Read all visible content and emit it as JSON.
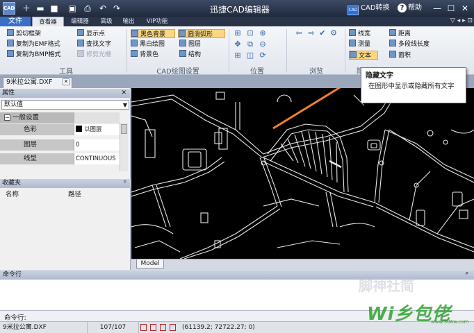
{
  "titlebar": {
    "logo": "CAD",
    "title": "迅捷CAD编辑器",
    "cad_convert": "CAD转换",
    "help": "帮助",
    "window_controls": [
      "minimize-icon",
      "maximize-icon",
      "close-icon"
    ]
  },
  "menu_tabs": [
    "文件",
    "查看器",
    "编辑器",
    "高级",
    "输出",
    "VIP功能"
  ],
  "active_tab": "查看器",
  "ribbon": {
    "tools": {
      "label": "工具",
      "items": [
        "剪切框架",
        "显示点",
        "复制为EMF格式",
        "查找文字",
        "复制为BMP格式",
        "修剪光栅"
      ],
      "disabled": [
        "修剪光栅"
      ]
    },
    "cad_settings": {
      "label": "CAD绘图设置",
      "items": [
        "黑色背景",
        "圆滑弧形",
        "黑白绘图",
        "图层",
        "背景色",
        "结构"
      ],
      "highlighted": [
        "黑色背景",
        "圆滑弧形"
      ]
    },
    "position": {
      "label": "位置"
    },
    "browse": {
      "label": "浏览"
    },
    "measure": {
      "label": "测量",
      "items": [
        "线宽",
        "距离",
        "测量",
        "多段线长度",
        "文本",
        "面积"
      ],
      "highlighted": [
        "文本"
      ]
    },
    "group_label_partial": "隐"
  },
  "tooltip": {
    "title": "隐藏文字",
    "body": "在图形中显示或隐藏所有文字"
  },
  "document_tab": "9米拉公寓.DXF",
  "properties": {
    "title": "属性",
    "select_value": "默认值",
    "section": "一般设置",
    "rows": [
      {
        "key": "色彩",
        "value": "以图层"
      },
      {
        "key": "图层",
        "value": "0"
      },
      {
        "key": "线型",
        "value": "CONTINUOUS"
      }
    ]
  },
  "favorites": {
    "title": "收藏夹",
    "columns": [
      "名称",
      "路径"
    ]
  },
  "model_tab": "Model",
  "command": {
    "header": "命令行",
    "input_label": "命令行:"
  },
  "status": {
    "file": "9米拉公寓.DXF",
    "pages": "107/107",
    "coords": "(61139.2; 72722.27; 0)"
  },
  "watermark": {
    "faint": "脚神社简",
    "brand": "Wi乡包佬",
    "url": "www.306w.com"
  },
  "colors": {
    "titlebar": "#1f2a3d",
    "ribbon_highlight": "#fcd680",
    "canvas_background": "#000000",
    "annotation_arrow": "#f08030"
  }
}
